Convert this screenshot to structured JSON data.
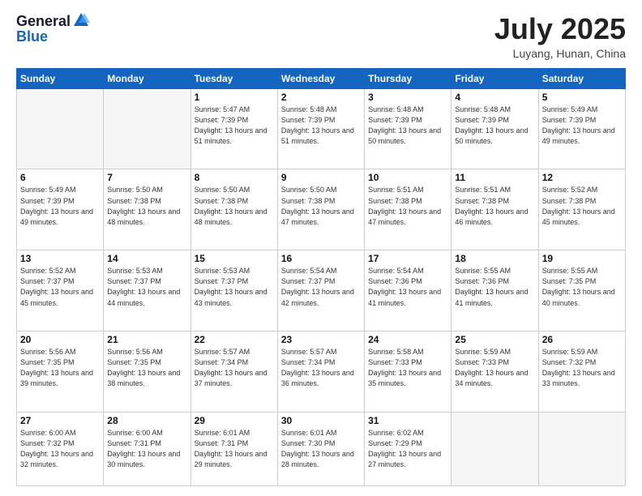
{
  "logo": {
    "general": "General",
    "blue": "Blue"
  },
  "title": {
    "month_year": "July 2025",
    "location": "Luyang, Hunan, China"
  },
  "weekdays": [
    "Sunday",
    "Monday",
    "Tuesday",
    "Wednesday",
    "Thursday",
    "Friday",
    "Saturday"
  ],
  "weeks": [
    [
      {
        "day": "",
        "info": ""
      },
      {
        "day": "",
        "info": ""
      },
      {
        "day": "1",
        "info": "Sunrise: 5:47 AM\nSunset: 7:39 PM\nDaylight: 13 hours and 51 minutes."
      },
      {
        "day": "2",
        "info": "Sunrise: 5:48 AM\nSunset: 7:39 PM\nDaylight: 13 hours and 51 minutes."
      },
      {
        "day": "3",
        "info": "Sunrise: 5:48 AM\nSunset: 7:39 PM\nDaylight: 13 hours and 50 minutes."
      },
      {
        "day": "4",
        "info": "Sunrise: 5:48 AM\nSunset: 7:39 PM\nDaylight: 13 hours and 50 minutes."
      },
      {
        "day": "5",
        "info": "Sunrise: 5:49 AM\nSunset: 7:39 PM\nDaylight: 13 hours and 49 minutes."
      }
    ],
    [
      {
        "day": "6",
        "info": "Sunrise: 5:49 AM\nSunset: 7:39 PM\nDaylight: 13 hours and 49 minutes."
      },
      {
        "day": "7",
        "info": "Sunrise: 5:50 AM\nSunset: 7:38 PM\nDaylight: 13 hours and 48 minutes."
      },
      {
        "day": "8",
        "info": "Sunrise: 5:50 AM\nSunset: 7:38 PM\nDaylight: 13 hours and 48 minutes."
      },
      {
        "day": "9",
        "info": "Sunrise: 5:50 AM\nSunset: 7:38 PM\nDaylight: 13 hours and 47 minutes."
      },
      {
        "day": "10",
        "info": "Sunrise: 5:51 AM\nSunset: 7:38 PM\nDaylight: 13 hours and 47 minutes."
      },
      {
        "day": "11",
        "info": "Sunrise: 5:51 AM\nSunset: 7:38 PM\nDaylight: 13 hours and 46 minutes."
      },
      {
        "day": "12",
        "info": "Sunrise: 5:52 AM\nSunset: 7:38 PM\nDaylight: 13 hours and 45 minutes."
      }
    ],
    [
      {
        "day": "13",
        "info": "Sunrise: 5:52 AM\nSunset: 7:37 PM\nDaylight: 13 hours and 45 minutes."
      },
      {
        "day": "14",
        "info": "Sunrise: 5:53 AM\nSunset: 7:37 PM\nDaylight: 13 hours and 44 minutes."
      },
      {
        "day": "15",
        "info": "Sunrise: 5:53 AM\nSunset: 7:37 PM\nDaylight: 13 hours and 43 minutes."
      },
      {
        "day": "16",
        "info": "Sunrise: 5:54 AM\nSunset: 7:37 PM\nDaylight: 13 hours and 42 minutes."
      },
      {
        "day": "17",
        "info": "Sunrise: 5:54 AM\nSunset: 7:36 PM\nDaylight: 13 hours and 41 minutes."
      },
      {
        "day": "18",
        "info": "Sunrise: 5:55 AM\nSunset: 7:36 PM\nDaylight: 13 hours and 41 minutes."
      },
      {
        "day": "19",
        "info": "Sunrise: 5:55 AM\nSunset: 7:35 PM\nDaylight: 13 hours and 40 minutes."
      }
    ],
    [
      {
        "day": "20",
        "info": "Sunrise: 5:56 AM\nSunset: 7:35 PM\nDaylight: 13 hours and 39 minutes."
      },
      {
        "day": "21",
        "info": "Sunrise: 5:56 AM\nSunset: 7:35 PM\nDaylight: 13 hours and 38 minutes."
      },
      {
        "day": "22",
        "info": "Sunrise: 5:57 AM\nSunset: 7:34 PM\nDaylight: 13 hours and 37 minutes."
      },
      {
        "day": "23",
        "info": "Sunrise: 5:57 AM\nSunset: 7:34 PM\nDaylight: 13 hours and 36 minutes."
      },
      {
        "day": "24",
        "info": "Sunrise: 5:58 AM\nSunset: 7:33 PM\nDaylight: 13 hours and 35 minutes."
      },
      {
        "day": "25",
        "info": "Sunrise: 5:59 AM\nSunset: 7:33 PM\nDaylight: 13 hours and 34 minutes."
      },
      {
        "day": "26",
        "info": "Sunrise: 5:59 AM\nSunset: 7:32 PM\nDaylight: 13 hours and 33 minutes."
      }
    ],
    [
      {
        "day": "27",
        "info": "Sunrise: 6:00 AM\nSunset: 7:32 PM\nDaylight: 13 hours and 32 minutes."
      },
      {
        "day": "28",
        "info": "Sunrise: 6:00 AM\nSunset: 7:31 PM\nDaylight: 13 hours and 30 minutes."
      },
      {
        "day": "29",
        "info": "Sunrise: 6:01 AM\nSunset: 7:31 PM\nDaylight: 13 hours and 29 minutes."
      },
      {
        "day": "30",
        "info": "Sunrise: 6:01 AM\nSunset: 7:30 PM\nDaylight: 13 hours and 28 minutes."
      },
      {
        "day": "31",
        "info": "Sunrise: 6:02 AM\nSunset: 7:29 PM\nDaylight: 13 hours and 27 minutes."
      },
      {
        "day": "",
        "info": ""
      },
      {
        "day": "",
        "info": ""
      }
    ]
  ]
}
